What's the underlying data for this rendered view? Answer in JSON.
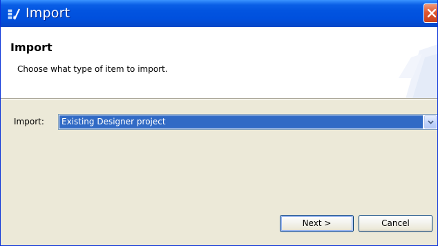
{
  "window": {
    "title": "Import",
    "title_icon": "import-wizard-icon",
    "close_icon": "close-icon"
  },
  "banner": {
    "title": "Import",
    "description": "Choose what type of item to import."
  },
  "form": {
    "import_label": "Import:",
    "import_selected": "Existing Designer project"
  },
  "buttons": {
    "next_label": "Next >",
    "cancel_label": "Cancel"
  },
  "colors": {
    "titlebar": "#0054e3",
    "selection": "#316ac5",
    "dialog_bg": "#ece9d8",
    "close": "#e0572f"
  }
}
